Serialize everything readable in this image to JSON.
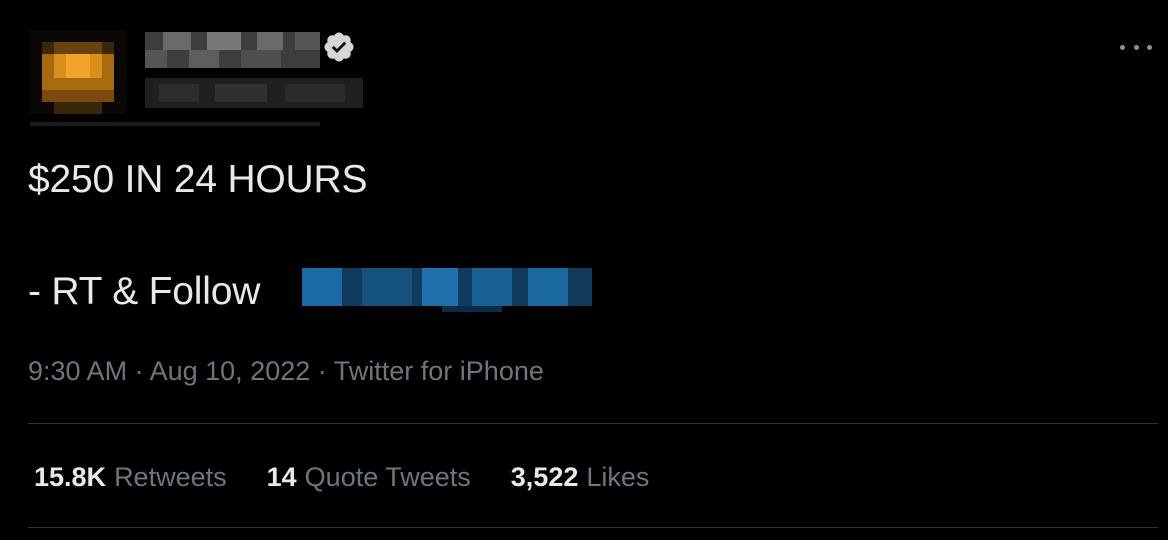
{
  "tweet": {
    "text_line1": "$250 IN 24 HOURS",
    "text_line2": "- RT & Follow",
    "time": "9:30 AM",
    "date": "Aug 10, 2022",
    "separator": "·",
    "source": "Twitter for iPhone"
  },
  "stats": [
    {
      "count": "15.8K",
      "label": "Retweets"
    },
    {
      "count": "14",
      "label": "Quote Tweets"
    },
    {
      "count": "3,522",
      "label": "Likes"
    }
  ],
  "icons": {
    "verified": "verified-badge-icon",
    "more": "more-horizontal-icon"
  },
  "colors": {
    "background": "#000000",
    "text_primary": "#e7e9ea",
    "text_secondary": "#6e767d",
    "divider": "#2f3336",
    "mention_blue": "#1d6fa8"
  }
}
